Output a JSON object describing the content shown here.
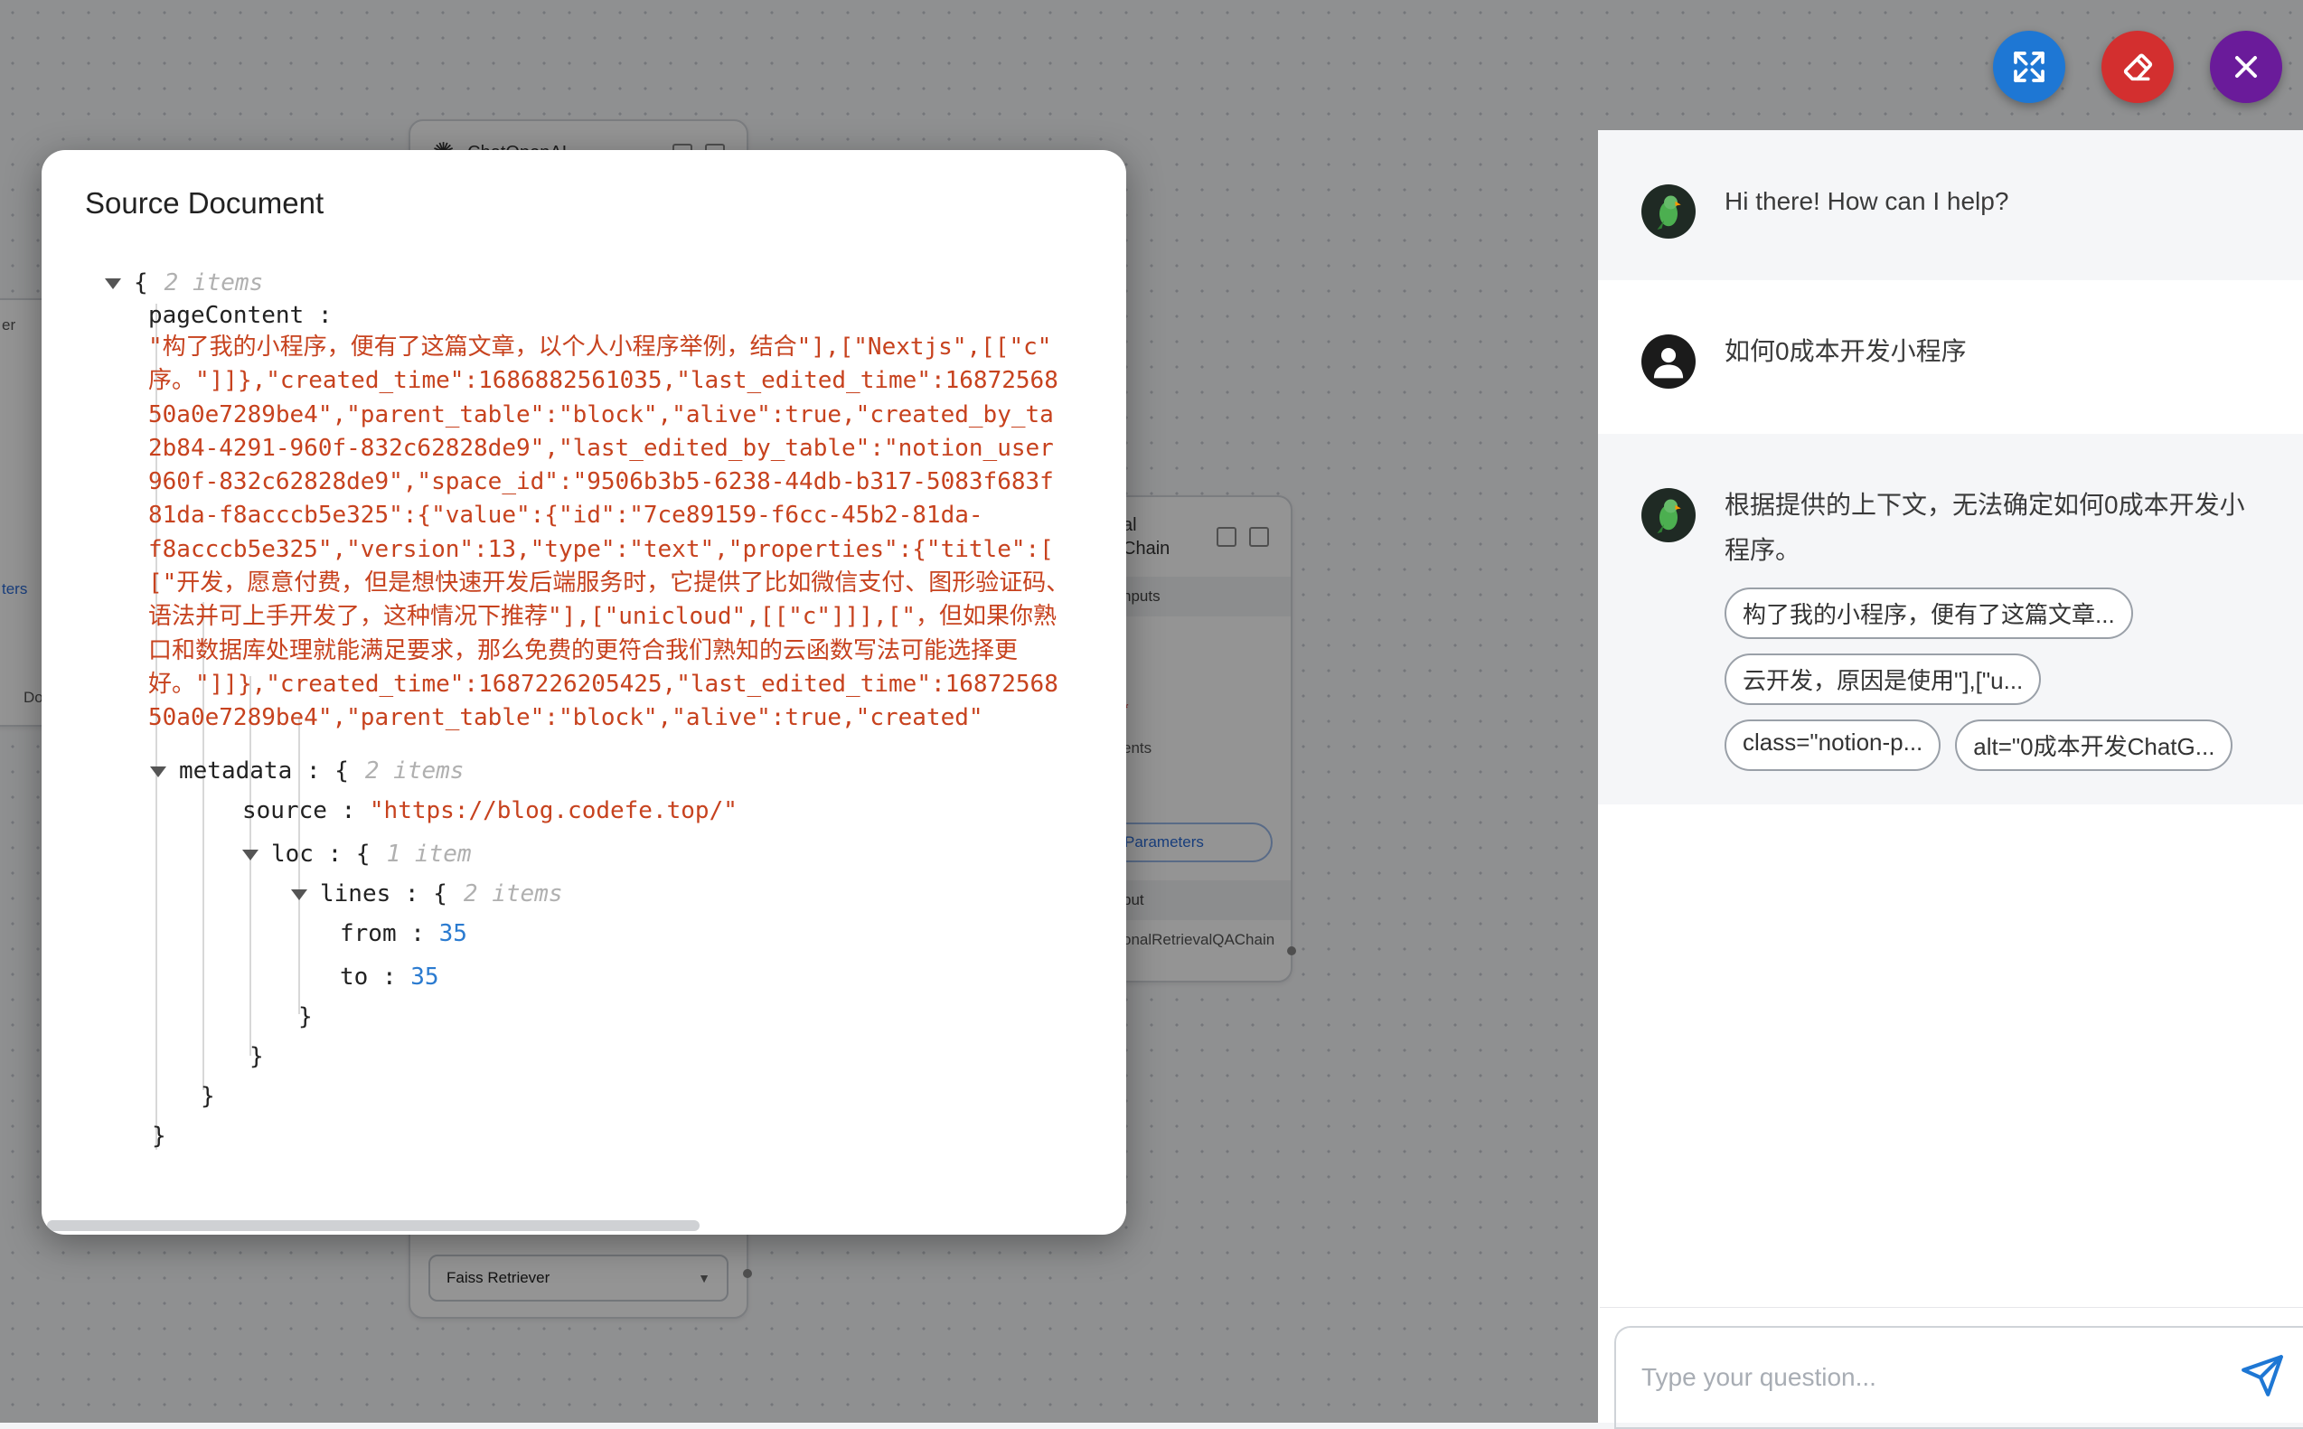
{
  "canvas": {
    "top_node_title": "ChatOpenAI",
    "chain_node_title_fragment": "al",
    "chain_node_title_fragment2": "Chain",
    "chain_node_section_inputs": "nputs",
    "chain_node_required_marker": "*",
    "chain_node_documents_fragment": "ents",
    "chain_node_params_button": "Parameters",
    "chain_node_output_section": "put",
    "chain_node_output_value": "onalRetrievalQAChain",
    "left_fragment_1": "er",
    "left_fragment_2": "ters",
    "left_fragment_3": "Do",
    "retriever_select_value": "Faiss Retriever"
  },
  "toolbar": {
    "expand_icon": "expand-icon",
    "clear_icon": "eraser-icon",
    "close_icon": "close-icon",
    "colors": {
      "expand": "#1e77d4",
      "clear": "#d32f2f",
      "close": "#6a1b9a"
    }
  },
  "chat": {
    "messages": [
      {
        "role": "bot",
        "text": "Hi there! How can I help?"
      },
      {
        "role": "user",
        "text": "如何0成本开发小程序"
      },
      {
        "role": "bot",
        "text": "根据提供的上下文，无法确定如何0成本开发小程序。",
        "sources": [
          "构了我的小程序，便有了这篇文章...",
          "云开发，原因是使用\"],[\"u...",
          "class=\"notion-p...",
          "alt=\"0成本开发ChatG..."
        ]
      }
    ],
    "input_placeholder": "Type your question..."
  },
  "dialog": {
    "title": "Source Document",
    "root_count": "2 items",
    "page_content_key": "pageContent",
    "page_content_lines": [
      "\"构了我的小程序，便有了这篇文章，以个人小程序举例，结合\"],[\"Nextjs\",[[\"c\"",
      "序。\"]]},\"created_time\":1686882561035,\"last_edited_time\":16872568",
      "50a0e7289be4\",\"parent_table\":\"block\",\"alive\":true,\"created_by_ta",
      "2b84-4291-960f-832c62828de9\",\"last_edited_by_table\":\"notion_user",
      "960f-832c62828de9\",\"space_id\":\"9506b3b5-6238-44db-b317-5083f683f",
      "81da-f8acccb5e325\":{\"value\":{\"id\":\"7ce89159-f6cc-45b2-81da-",
      "f8acccb5e325\",\"version\":13,\"type\":\"text\",\"properties\":{\"title\":[",
      "[\"开发，愿意付费，但是想快速开发后端服务时，它提供了比如微信支付、图形验证码、",
      "语法并可上手开发了，这种情况下推荐\"],[\"unicloud\",[[\"c\"]]],[\"，但如果你熟",
      "口和数据库处理就能满足要求，那么免费的更符合我们熟知的云函数写法可能选择更",
      "好。\"]]},\"created_time\":1687226205425,\"last_edited_time\":16872568",
      "50a0e7289be4\",\"parent_table\":\"block\",\"alive\":true,\"created\""
    ],
    "metadata_key": "metadata",
    "metadata_count": "2 items",
    "source_key": "source",
    "source_value": "\"https://blog.codefe.top/\"",
    "loc_key": "loc",
    "loc_count": "1 item",
    "lines_key": "lines",
    "lines_count": "2 items",
    "from_key": "from",
    "from_value": "35",
    "to_key": "to",
    "to_value": "35"
  }
}
